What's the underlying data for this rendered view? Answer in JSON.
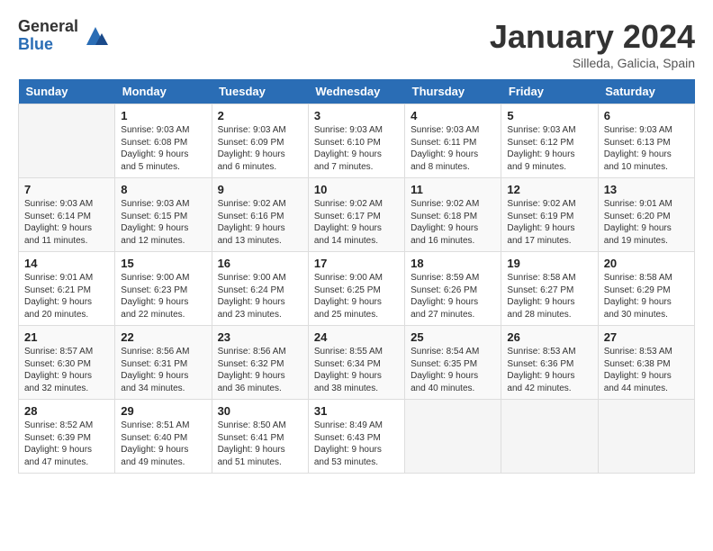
{
  "header": {
    "logo_general": "General",
    "logo_blue": "Blue",
    "month_title": "January 2024",
    "location": "Silleda, Galicia, Spain"
  },
  "weekdays": [
    "Sunday",
    "Monday",
    "Tuesday",
    "Wednesday",
    "Thursday",
    "Friday",
    "Saturday"
  ],
  "weeks": [
    [
      {
        "day": "",
        "sunrise": "",
        "sunset": "",
        "daylight": ""
      },
      {
        "day": "1",
        "sunrise": "Sunrise: 9:03 AM",
        "sunset": "Sunset: 6:08 PM",
        "daylight": "Daylight: 9 hours and 5 minutes."
      },
      {
        "day": "2",
        "sunrise": "Sunrise: 9:03 AM",
        "sunset": "Sunset: 6:09 PM",
        "daylight": "Daylight: 9 hours and 6 minutes."
      },
      {
        "day": "3",
        "sunrise": "Sunrise: 9:03 AM",
        "sunset": "Sunset: 6:10 PM",
        "daylight": "Daylight: 9 hours and 7 minutes."
      },
      {
        "day": "4",
        "sunrise": "Sunrise: 9:03 AM",
        "sunset": "Sunset: 6:11 PM",
        "daylight": "Daylight: 9 hours and 8 minutes."
      },
      {
        "day": "5",
        "sunrise": "Sunrise: 9:03 AM",
        "sunset": "Sunset: 6:12 PM",
        "daylight": "Daylight: 9 hours and 9 minutes."
      },
      {
        "day": "6",
        "sunrise": "Sunrise: 9:03 AM",
        "sunset": "Sunset: 6:13 PM",
        "daylight": "Daylight: 9 hours and 10 minutes."
      }
    ],
    [
      {
        "day": "7",
        "sunrise": "Sunrise: 9:03 AM",
        "sunset": "Sunset: 6:14 PM",
        "daylight": "Daylight: 9 hours and 11 minutes."
      },
      {
        "day": "8",
        "sunrise": "Sunrise: 9:03 AM",
        "sunset": "Sunset: 6:15 PM",
        "daylight": "Daylight: 9 hours and 12 minutes."
      },
      {
        "day": "9",
        "sunrise": "Sunrise: 9:02 AM",
        "sunset": "Sunset: 6:16 PM",
        "daylight": "Daylight: 9 hours and 13 minutes."
      },
      {
        "day": "10",
        "sunrise": "Sunrise: 9:02 AM",
        "sunset": "Sunset: 6:17 PM",
        "daylight": "Daylight: 9 hours and 14 minutes."
      },
      {
        "day": "11",
        "sunrise": "Sunrise: 9:02 AM",
        "sunset": "Sunset: 6:18 PM",
        "daylight": "Daylight: 9 hours and 16 minutes."
      },
      {
        "day": "12",
        "sunrise": "Sunrise: 9:02 AM",
        "sunset": "Sunset: 6:19 PM",
        "daylight": "Daylight: 9 hours and 17 minutes."
      },
      {
        "day": "13",
        "sunrise": "Sunrise: 9:01 AM",
        "sunset": "Sunset: 6:20 PM",
        "daylight": "Daylight: 9 hours and 19 minutes."
      }
    ],
    [
      {
        "day": "14",
        "sunrise": "Sunrise: 9:01 AM",
        "sunset": "Sunset: 6:21 PM",
        "daylight": "Daylight: 9 hours and 20 minutes."
      },
      {
        "day": "15",
        "sunrise": "Sunrise: 9:00 AM",
        "sunset": "Sunset: 6:23 PM",
        "daylight": "Daylight: 9 hours and 22 minutes."
      },
      {
        "day": "16",
        "sunrise": "Sunrise: 9:00 AM",
        "sunset": "Sunset: 6:24 PM",
        "daylight": "Daylight: 9 hours and 23 minutes."
      },
      {
        "day": "17",
        "sunrise": "Sunrise: 9:00 AM",
        "sunset": "Sunset: 6:25 PM",
        "daylight": "Daylight: 9 hours and 25 minutes."
      },
      {
        "day": "18",
        "sunrise": "Sunrise: 8:59 AM",
        "sunset": "Sunset: 6:26 PM",
        "daylight": "Daylight: 9 hours and 27 minutes."
      },
      {
        "day": "19",
        "sunrise": "Sunrise: 8:58 AM",
        "sunset": "Sunset: 6:27 PM",
        "daylight": "Daylight: 9 hours and 28 minutes."
      },
      {
        "day": "20",
        "sunrise": "Sunrise: 8:58 AM",
        "sunset": "Sunset: 6:29 PM",
        "daylight": "Daylight: 9 hours and 30 minutes."
      }
    ],
    [
      {
        "day": "21",
        "sunrise": "Sunrise: 8:57 AM",
        "sunset": "Sunset: 6:30 PM",
        "daylight": "Daylight: 9 hours and 32 minutes."
      },
      {
        "day": "22",
        "sunrise": "Sunrise: 8:56 AM",
        "sunset": "Sunset: 6:31 PM",
        "daylight": "Daylight: 9 hours and 34 minutes."
      },
      {
        "day": "23",
        "sunrise": "Sunrise: 8:56 AM",
        "sunset": "Sunset: 6:32 PM",
        "daylight": "Daylight: 9 hours and 36 minutes."
      },
      {
        "day": "24",
        "sunrise": "Sunrise: 8:55 AM",
        "sunset": "Sunset: 6:34 PM",
        "daylight": "Daylight: 9 hours and 38 minutes."
      },
      {
        "day": "25",
        "sunrise": "Sunrise: 8:54 AM",
        "sunset": "Sunset: 6:35 PM",
        "daylight": "Daylight: 9 hours and 40 minutes."
      },
      {
        "day": "26",
        "sunrise": "Sunrise: 8:53 AM",
        "sunset": "Sunset: 6:36 PM",
        "daylight": "Daylight: 9 hours and 42 minutes."
      },
      {
        "day": "27",
        "sunrise": "Sunrise: 8:53 AM",
        "sunset": "Sunset: 6:38 PM",
        "daylight": "Daylight: 9 hours and 44 minutes."
      }
    ],
    [
      {
        "day": "28",
        "sunrise": "Sunrise: 8:52 AM",
        "sunset": "Sunset: 6:39 PM",
        "daylight": "Daylight: 9 hours and 47 minutes."
      },
      {
        "day": "29",
        "sunrise": "Sunrise: 8:51 AM",
        "sunset": "Sunset: 6:40 PM",
        "daylight": "Daylight: 9 hours and 49 minutes."
      },
      {
        "day": "30",
        "sunrise": "Sunrise: 8:50 AM",
        "sunset": "Sunset: 6:41 PM",
        "daylight": "Daylight: 9 hours and 51 minutes."
      },
      {
        "day": "31",
        "sunrise": "Sunrise: 8:49 AM",
        "sunset": "Sunset: 6:43 PM",
        "daylight": "Daylight: 9 hours and 53 minutes."
      },
      {
        "day": "",
        "sunrise": "",
        "sunset": "",
        "daylight": ""
      },
      {
        "day": "",
        "sunrise": "",
        "sunset": "",
        "daylight": ""
      },
      {
        "day": "",
        "sunrise": "",
        "sunset": "",
        "daylight": ""
      }
    ]
  ]
}
